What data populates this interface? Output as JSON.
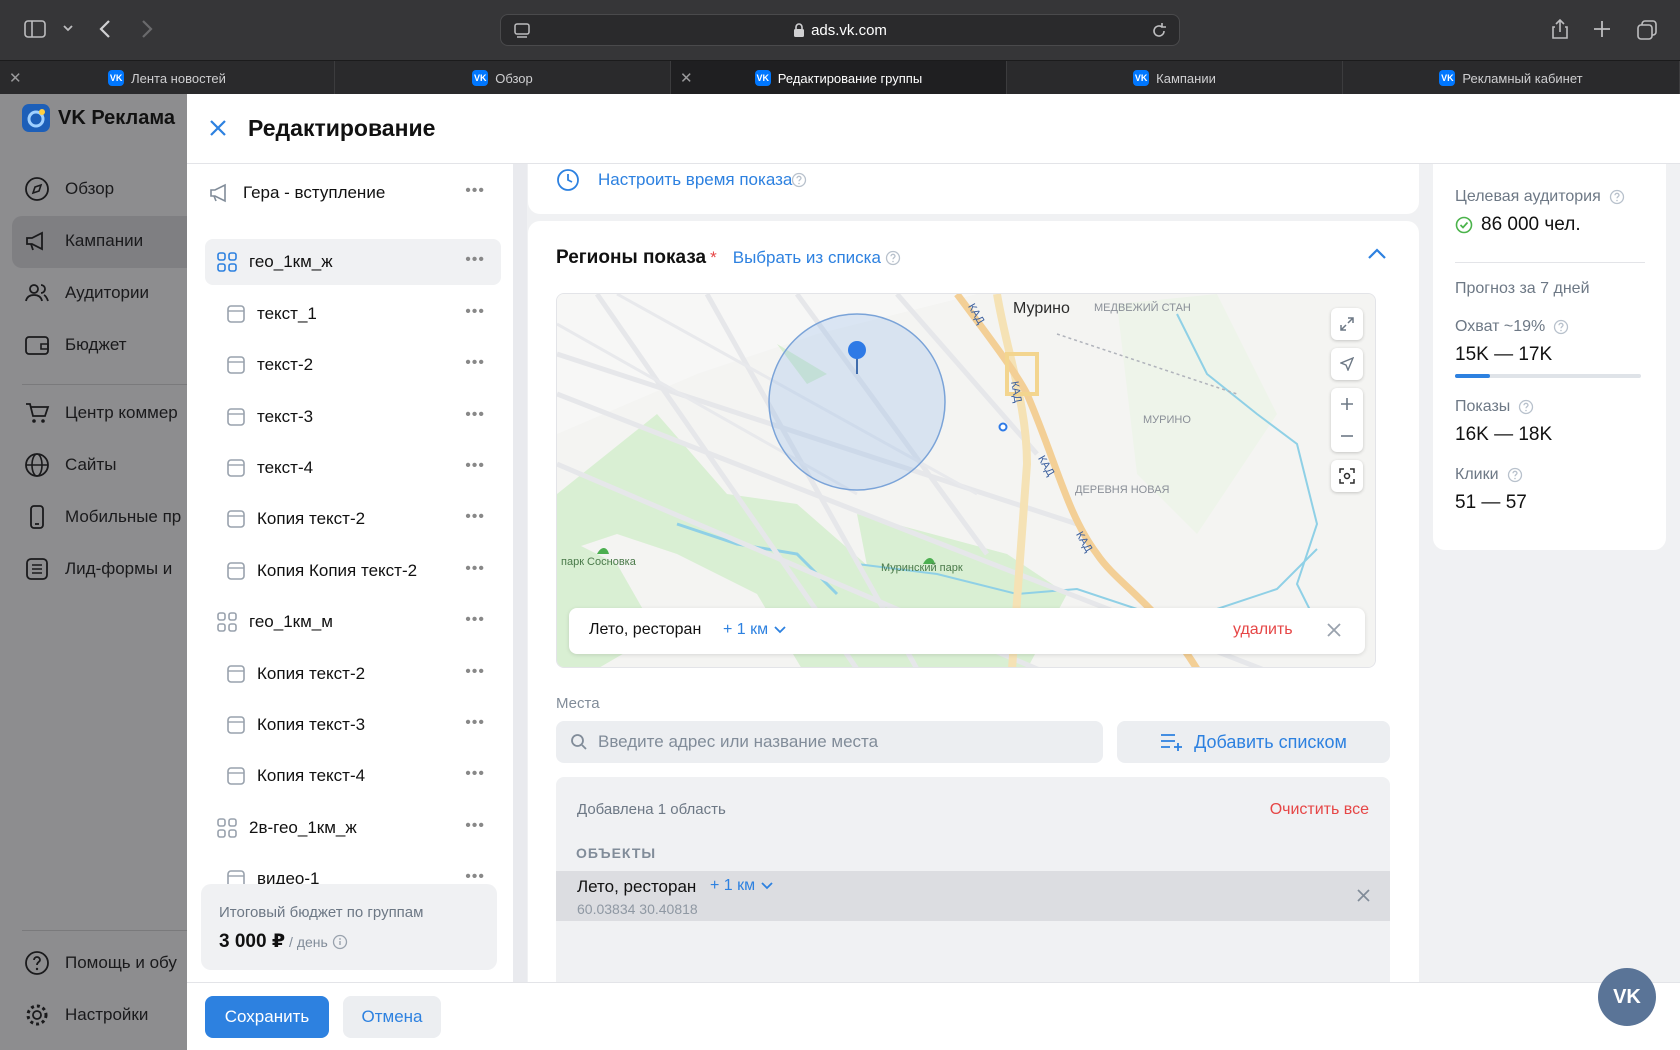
{
  "browser": {
    "url": "ads.vk.com",
    "tabs": [
      {
        "label": "Лента новостей",
        "active": false
      },
      {
        "label": "Обзор",
        "active": false
      },
      {
        "label": "Редактирование группы",
        "active": true
      },
      {
        "label": "Кампании",
        "active": false
      },
      {
        "label": "Рекламный кабинет",
        "active": false
      }
    ]
  },
  "app": {
    "brand": "VK Реклама",
    "nav": [
      "Обзор",
      "Кампании",
      "Аудитории",
      "Бюджет",
      "Центр коммер",
      "Сайты",
      "Мобильные пр",
      "Лид-формы и"
    ],
    "nav_bottom": [
      "Помощь и обу",
      "Настройки"
    ]
  },
  "modal": {
    "title": "Редактирование",
    "tree": [
      {
        "label": "Гера - вступление",
        "kind": "campaign"
      },
      {
        "label": "гео_1км_ж",
        "kind": "group",
        "selected": true
      },
      {
        "label": "текст_1",
        "kind": "ad"
      },
      {
        "label": "текст-2",
        "kind": "ad"
      },
      {
        "label": "текст-3",
        "kind": "ad"
      },
      {
        "label": "текст-4",
        "kind": "ad"
      },
      {
        "label": "Копия текст-2",
        "kind": "ad"
      },
      {
        "label": "Копия Копия текст-2",
        "kind": "ad"
      },
      {
        "label": "гео_1км_м",
        "kind": "group"
      },
      {
        "label": "Копия текст-2",
        "kind": "ad"
      },
      {
        "label": "Копия текст-3",
        "kind": "ad"
      },
      {
        "label": "Копия текст-4",
        "kind": "ad"
      },
      {
        "label": "2в-гео_1км_ж",
        "kind": "group"
      },
      {
        "label": "видео-1",
        "kind": "ad"
      }
    ],
    "budget": {
      "label": "Итоговый бюджет по группам",
      "amount": "3 000 ₽",
      "unit": "/ день"
    },
    "save": "Сохранить",
    "cancel": "Отмена",
    "time_link": "Настроить время показа",
    "regions": {
      "title": "Регионы показа",
      "required": "*",
      "choose_list": "Выбрать из списка",
      "map_labels": {
        "murino": "Мурино",
        "medvezhiy": "МЕДВЕЖИЙ СТАН",
        "murino2": "МУРИНО",
        "derevnya": "ДЕРЕВНЯ НОВАЯ",
        "park1": "парк Сосновка",
        "park2": "Муринский парк",
        "kad": "КАД"
      },
      "place_chip": {
        "name": "Лето, ресторан",
        "radius": "+ 1 км",
        "delete": "удалить"
      },
      "places_label": "Места",
      "search_placeholder": "Введите адрес или название места",
      "add_list": "Добавить списком",
      "added": "Добавлена 1 область",
      "clear_all": "Очистить все",
      "objects_header": "ОБЪЕКТЫ",
      "object": {
        "name": "Лето, ресторан",
        "radius": "+ 1 км",
        "coords": "60.03834 30.40818"
      }
    },
    "audience": {
      "label": "Целевая аудитория",
      "value": "86 000 чел.",
      "forecast": "Прогноз за 7 дней",
      "reach_label": "Охват ~19%",
      "reach_value": "15K — 17K",
      "reach_progress": 0.19,
      "shows_label": "Показы",
      "shows_value": "16K — 18K",
      "clicks_label": "Клики",
      "clicks_value": "51 — 57"
    }
  }
}
